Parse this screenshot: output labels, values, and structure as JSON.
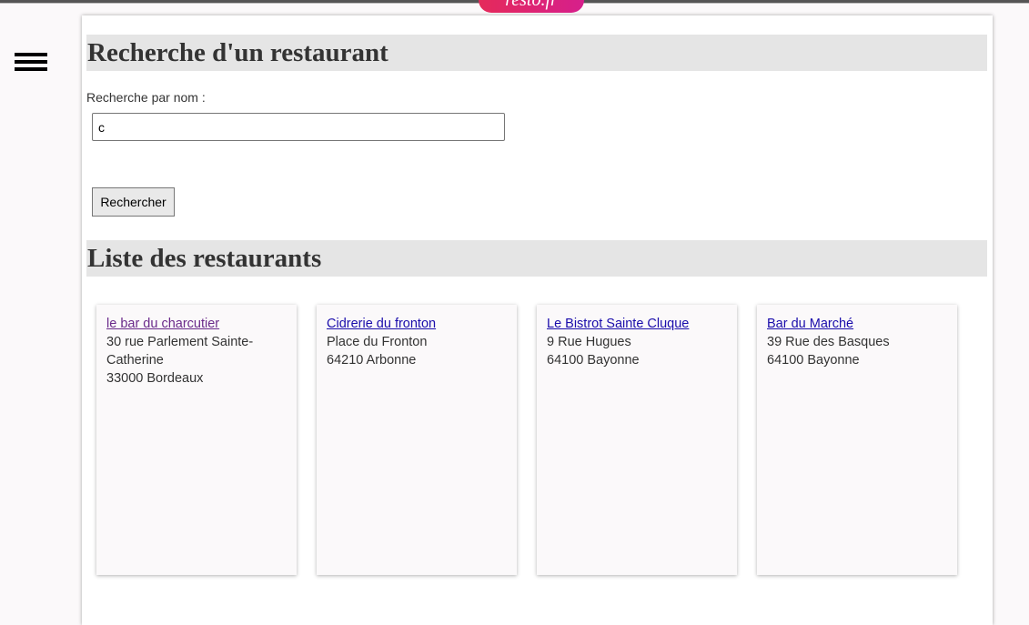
{
  "header": {
    "logo_text": "resto.fr"
  },
  "search_section": {
    "title": "Recherche d'un restaurant",
    "label": "Recherche par nom :",
    "input_value": "c",
    "button_label": "Rechercher"
  },
  "list_section": {
    "title": "Liste des restaurants",
    "restaurants": [
      {
        "name": "le bar du charcutier",
        "address": "30 rue Parlement Sainte-Catherine",
        "city": "33000 Bordeaux",
        "visited": true
      },
      {
        "name": "Cidrerie du fronton",
        "address": "Place du Fronton",
        "city": "64210 Arbonne",
        "visited": false
      },
      {
        "name": "Le Bistrot Sainte Cluque",
        "address": "9 Rue Hugues",
        "city": "64100 Bayonne",
        "visited": false
      },
      {
        "name": "Bar du Marché",
        "address": "39 Rue des Basques",
        "city": "64100 Bayonne",
        "visited": false
      }
    ]
  }
}
